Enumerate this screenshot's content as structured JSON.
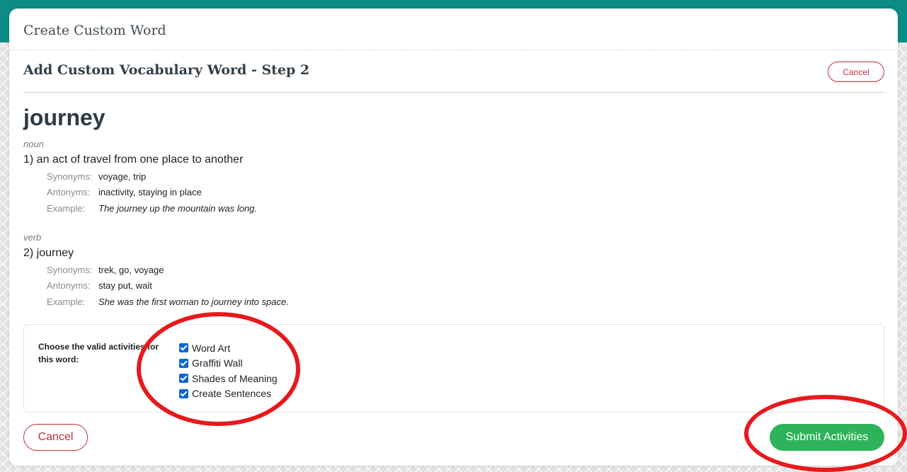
{
  "modal": {
    "title": "Create Custom Word",
    "step_title": "Add Custom Vocabulary Word - Step 2",
    "cancel_small": "Cancel"
  },
  "word": "journey",
  "senses": [
    {
      "pos": "noun",
      "definition": "1) an act of travel from one place to another",
      "synonyms_label": "Synonyms:",
      "synonyms": "voyage, trip",
      "antonyms_label": "Antonyms:",
      "antonyms": "inactivity, staying in place",
      "example_label": "Example:",
      "example": "The journey up the mountain was long."
    },
    {
      "pos": "verb",
      "definition": "2) journey",
      "synonyms_label": "Synonyms:",
      "synonyms": "trek, go, voyage",
      "antonyms_label": "Antonyms:",
      "antonyms": "stay put, wait",
      "example_label": "Example:",
      "example": "She was the first woman to journey into space."
    }
  ],
  "activities": {
    "prompt": "Choose the valid activities for this word:",
    "items": [
      {
        "label": "Word Art",
        "checked": true
      },
      {
        "label": "Graffiti Wall",
        "checked": true
      },
      {
        "label": "Shades of Meaning",
        "checked": true
      },
      {
        "label": "Create Sentences",
        "checked": true
      }
    ]
  },
  "footer": {
    "cancel_label": "Cancel",
    "submit_label": "Submit Activities"
  },
  "colors": {
    "topbar": "#0c8c86",
    "cancel": "#c0303a",
    "submit": "#2fb35a",
    "checkbox": "#0b65d8",
    "annotation": "#e6191d"
  }
}
